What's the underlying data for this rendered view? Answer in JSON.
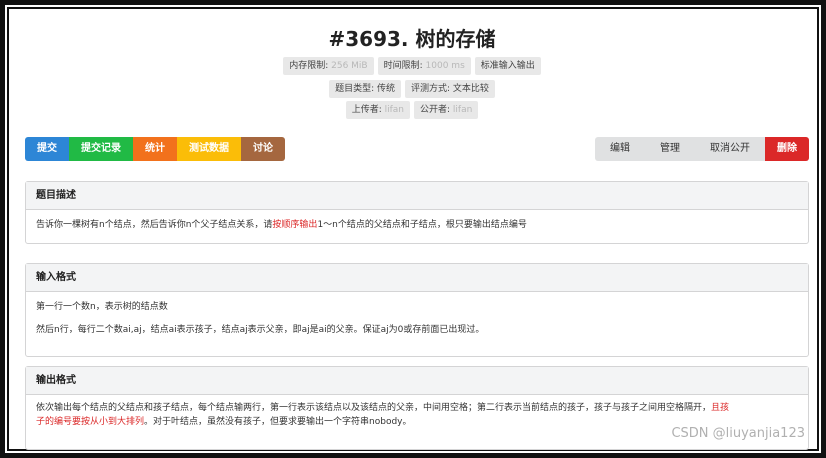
{
  "problem": {
    "title": "#3693. 树的存储"
  },
  "meta": {
    "row1": [
      {
        "label": "内存限制:",
        "value": "256 MiB"
      },
      {
        "label": "时间限制:",
        "value": "1000 ms"
      },
      {
        "label": "标准输入输出",
        "value": ""
      }
    ],
    "row2": [
      {
        "label": "题目类型:",
        "value": "传统"
      },
      {
        "label": "评测方式:",
        "value": "文本比较"
      }
    ],
    "row3": [
      {
        "label": "上传者:",
        "value": "lifan"
      },
      {
        "label": "公开者:",
        "value": "lifan"
      }
    ]
  },
  "toolbar_left": [
    "提交",
    "提交记录",
    "统计",
    "测试数据",
    "讨论"
  ],
  "toolbar_right": [
    "编辑",
    "管理",
    "取消公开",
    "删除"
  ],
  "sections": {
    "description": {
      "header": "题目描述",
      "text_before": "告诉你一棵树有n个结点，然后告诉你n个父子结点关系，请",
      "text_red": "按顺序输出",
      "text_after": "1～n个结点的父结点和子结点，根只要输出结点编号"
    },
    "input": {
      "header": "输入格式",
      "line1": "第一行一个数n，表示树的结点数",
      "line2": "然后n行，每行二个数ai,aj，结点ai表示孩子，结点aj表示父亲，即aj是ai的父亲。保证aj为0或存前面已出现过。"
    },
    "output": {
      "header": "输出格式",
      "text_before": "依次输出每个结点的父结点和孩子结点，每个结点输两行，第一行表示该结点以及该结点的父亲，中间用空格；第二行表示当前结点的孩子，孩子与孩子之间用空格隔开，",
      "text_red": "且孩子的编号要按从小到大排列",
      "text_after": "。对于叶结点，虽然没有孩子，但要求要输出一个字符串nobody。"
    }
  },
  "watermark": "CSDN @liuyanjia123"
}
